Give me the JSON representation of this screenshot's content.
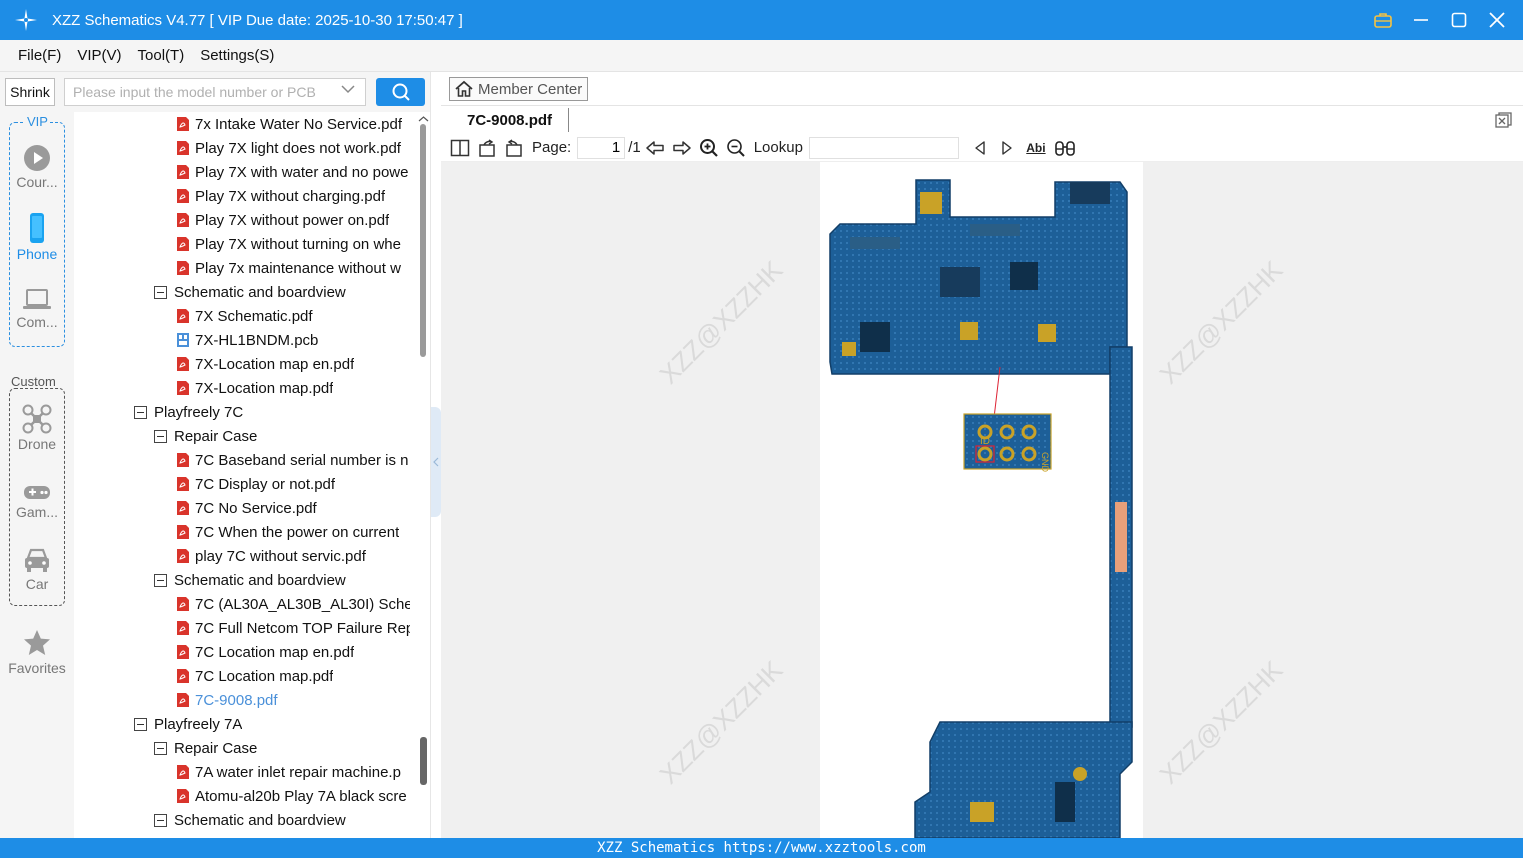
{
  "titlebar": {
    "title": "XZZ Schematics V4.77 [ VIP Due date: 2025-10-30 17:50:47 ]"
  },
  "menu": [
    "File(F)",
    "VIP(V)",
    "Tool(T)",
    "Settings(S)"
  ],
  "search": {
    "shrink_label": "Shrink",
    "placeholder": "Please input the model number or PCB"
  },
  "sidebar": {
    "vip_label": "VIP",
    "custom_label": "Custom",
    "items": [
      {
        "label": "Cour...",
        "icon": "play-circle-icon"
      },
      {
        "label": "Phone",
        "icon": "phone-icon"
      },
      {
        "label": "Com...",
        "icon": "laptop-icon"
      },
      {
        "label": "Drone",
        "icon": "drone-icon"
      },
      {
        "label": "Gam...",
        "icon": "gamepad-icon"
      },
      {
        "label": "Car",
        "icon": "car-icon"
      },
      {
        "label": "Favorites",
        "icon": "star-icon"
      }
    ]
  },
  "tree": [
    {
      "label": "7x Intake Water No Service.pdf",
      "level": 2,
      "type": "pdf"
    },
    {
      "label": "Play 7X light does not work.pdf",
      "level": 2,
      "type": "pdf"
    },
    {
      "label": "Play 7X with water and no powe",
      "level": 2,
      "type": "pdf"
    },
    {
      "label": "Play 7X without charging.pdf",
      "level": 2,
      "type": "pdf"
    },
    {
      "label": "Play 7X without power on.pdf",
      "level": 2,
      "type": "pdf"
    },
    {
      "label": "Play 7X without turning on whe",
      "level": 2,
      "type": "pdf"
    },
    {
      "label": "Play 7x maintenance without w",
      "level": 2,
      "type": "pdf"
    },
    {
      "label": "Schematic and boardview",
      "level": 1,
      "type": "folder"
    },
    {
      "label": "7X Schematic.pdf",
      "level": 2,
      "type": "pdf"
    },
    {
      "label": "7X-HL1BNDM.pcb",
      "level": 2,
      "type": "pcb"
    },
    {
      "label": "7X-Location map en.pdf",
      "level": 2,
      "type": "pdf"
    },
    {
      "label": "7X-Location map.pdf",
      "level": 2,
      "type": "pdf"
    },
    {
      "label": "Playfreely 7C",
      "level": 0,
      "type": "folder"
    },
    {
      "label": "Repair Case",
      "level": 1,
      "type": "folder"
    },
    {
      "label": "7C Baseband serial number is n",
      "level": 2,
      "type": "pdf"
    },
    {
      "label": "7C Display or not.pdf",
      "level": 2,
      "type": "pdf"
    },
    {
      "label": "7C No Service.pdf",
      "level": 2,
      "type": "pdf"
    },
    {
      "label": "7C When the power on current",
      "level": 2,
      "type": "pdf"
    },
    {
      "label": "play 7C without servic.pdf",
      "level": 2,
      "type": "pdf"
    },
    {
      "label": "Schematic and boardview",
      "level": 1,
      "type": "folder"
    },
    {
      "label": "7C (AL30A_AL30B_AL30I) Schem",
      "level": 2,
      "type": "pdf"
    },
    {
      "label": "7C Full Netcom TOP Failure Rep",
      "level": 2,
      "type": "pdf"
    },
    {
      "label": "7C Location map en.pdf",
      "level": 2,
      "type": "pdf"
    },
    {
      "label": "7C Location map.pdf",
      "level": 2,
      "type": "pdf"
    },
    {
      "label": "7C-9008.pdf",
      "level": 2,
      "type": "pdf",
      "selected": true
    },
    {
      "label": "Playfreely 7A",
      "level": 0,
      "type": "folder"
    },
    {
      "label": "Repair Case",
      "level": 1,
      "type": "folder"
    },
    {
      "label": "7A water inlet repair machine.p",
      "level": 2,
      "type": "pdf"
    },
    {
      "label": "Atomu-al20b Play 7A black scre",
      "level": 2,
      "type": "pdf"
    },
    {
      "label": "Schematic and boardview",
      "level": 1,
      "type": "folder"
    }
  ],
  "member_center": {
    "label": "Member Center"
  },
  "doc_tab": {
    "label": "7C-9008.pdf"
  },
  "toolbar": {
    "page_label": "Page:",
    "page_value": "1",
    "page_total": "/1",
    "lookup_label": "Lookup",
    "abi_label": "Abi"
  },
  "watermark": "XZZ@XZZHK",
  "board_labels": {
    "id": "ID",
    "gnd": "GND"
  },
  "statusbar": {
    "text": "XZZ Schematics https://www.xzztools.com"
  },
  "colors": {
    "accent": "#1e8de6",
    "pdf_icon": "#d9342b",
    "board": "#1d5f98",
    "selected": "#4a90d9"
  }
}
